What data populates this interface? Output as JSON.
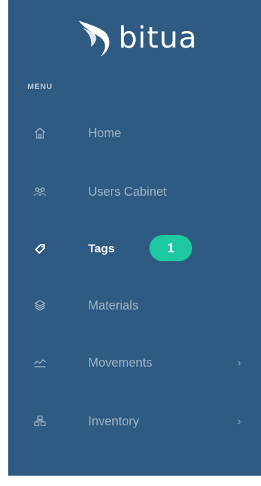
{
  "brand": {
    "name": "bitua"
  },
  "menu": {
    "section_label": "MENU",
    "items": [
      {
        "label": "Home",
        "icon": "home-icon",
        "active": false,
        "has_submenu": false
      },
      {
        "label": "Users Cabinet",
        "icon": "users-icon",
        "active": false,
        "has_submenu": false
      },
      {
        "label": "Tags",
        "icon": "tag-icon",
        "active": true,
        "has_submenu": false
      },
      {
        "label": "Materials",
        "icon": "layers-icon",
        "active": false,
        "has_submenu": false
      },
      {
        "label": "Movements",
        "icon": "movements-icon",
        "active": false,
        "has_submenu": true,
        "chevron": "›"
      },
      {
        "label": "Inventory",
        "icon": "inventory-icon",
        "active": false,
        "has_submenu": true,
        "chevron": "›"
      }
    ]
  },
  "annotation": {
    "badge": "1"
  },
  "colors": {
    "sidebar_bg": "#2f5b82",
    "text_muted": "#9fb4c8",
    "text_active": "#ffffff",
    "badge_bg": "#1cc9a0"
  }
}
